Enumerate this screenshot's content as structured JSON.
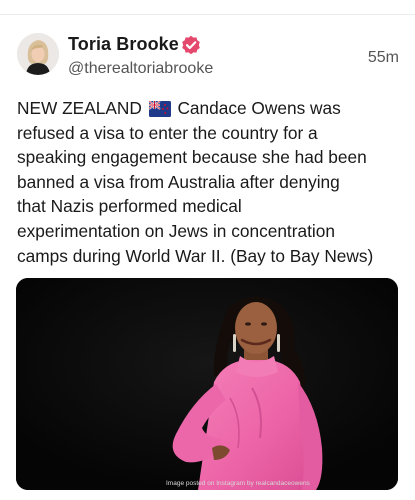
{
  "post": {
    "author_name": "Toria Brooke",
    "handle": "@therealtoriabrooke",
    "timestamp": "55m",
    "text_lines": [
      "NEW ZEALAND",
      "Candace Owens was",
      "refused a visa to enter the country for a",
      "speaking engagement because she had been",
      "banned a visa from Australia after denying",
      "that Nazis performed medical",
      "experimentation on Jews in concentration",
      "camps during World War II. (Bay to Bay News)"
    ],
    "image_caption": "Image posted on Instagram by realcandaceowens"
  },
  "icons": {
    "verified": "verified-badge-icon",
    "flag": "new-zealand-flag-icon"
  },
  "colors": {
    "verified_badge": "#e5486d",
    "media_background": "#070707",
    "blouse": "#ef6fae"
  }
}
